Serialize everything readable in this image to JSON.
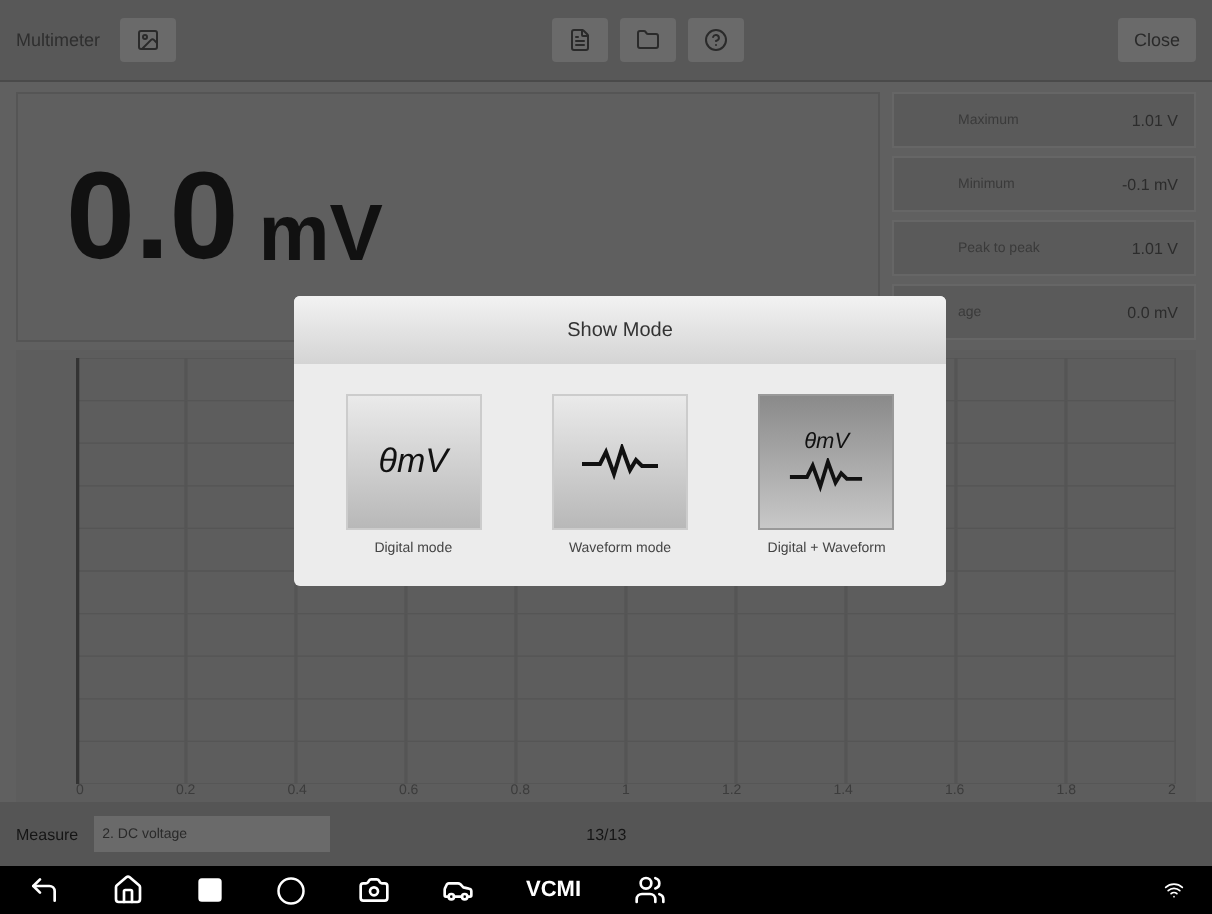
{
  "toolbar": {
    "title": "Multimeter",
    "close_label": "Close"
  },
  "reading": {
    "value": "0.0",
    "unit": "mV"
  },
  "stats": [
    {
      "label": "Maximum",
      "value": "1.01 V"
    },
    {
      "label": "Minimum",
      "value": "-0.1 mV"
    },
    {
      "label": "Peak to peak",
      "value": "1.01 V"
    },
    {
      "label": "age",
      "value": "0.0 mV"
    }
  ],
  "x_axis_labels": [
    "0",
    "0.2",
    "0.4",
    "0.6",
    "0.8",
    "1",
    "1.2",
    "1.4",
    "1.6",
    "1.8",
    "2"
  ],
  "controls": {
    "measure_label": "Measure",
    "measure_value": "2. DC voltage",
    "page": "13/13"
  },
  "dialog": {
    "title": "Show Mode",
    "options": [
      {
        "kind": "digital",
        "label": "Digital mode",
        "glyph": "θmV",
        "selected": false
      },
      {
        "kind": "waveform",
        "label": "Waveform mode",
        "selected": false
      },
      {
        "kind": "both",
        "label": "Digital + Waveform",
        "glyph": "θmV",
        "selected": true
      }
    ]
  },
  "navbar": {
    "vci_label": "VCMI"
  }
}
